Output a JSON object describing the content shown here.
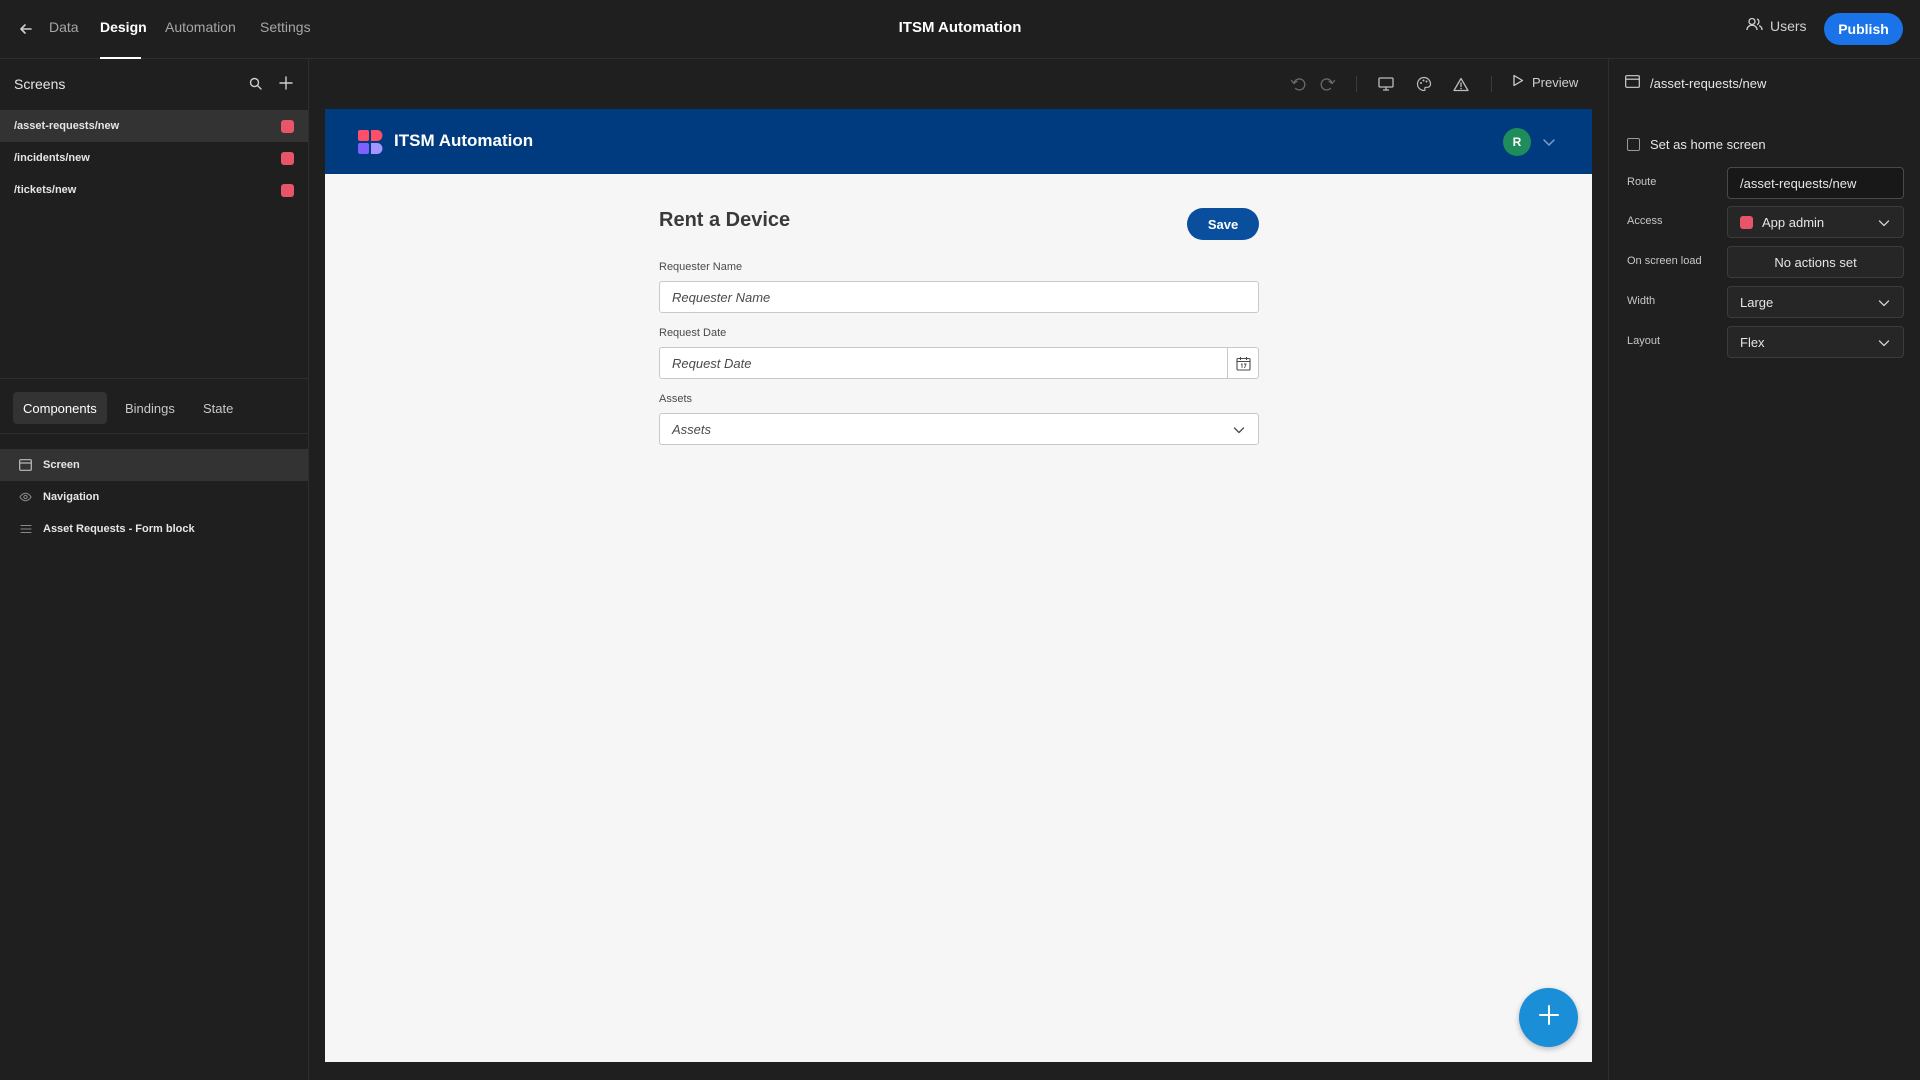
{
  "topbar": {
    "tabs": [
      "Data",
      "Design",
      "Automation",
      "Settings"
    ],
    "active_tab": "Design",
    "title": "ITSM Automation",
    "users_label": "Users",
    "publish_label": "Publish"
  },
  "screens": {
    "header": "Screens",
    "items": [
      {
        "route": "/asset-requests/new",
        "selected": true,
        "color": "#e8546a"
      },
      {
        "route": "/incidents/new",
        "selected": false,
        "color": "#e8546a"
      },
      {
        "route": "/tickets/new",
        "selected": false,
        "color": "#e8546a"
      }
    ]
  },
  "components_panel": {
    "tabs": [
      "Components",
      "Bindings",
      "State"
    ],
    "active_tab": "Components",
    "tree": [
      {
        "label": "Screen",
        "icon": "screen-icon",
        "selected": true
      },
      {
        "label": "Navigation",
        "icon": "eye-icon",
        "selected": false
      },
      {
        "label": "Asset Requests - Form block",
        "icon": "form-lines-icon",
        "selected": false
      }
    ]
  },
  "toolbar": {
    "icons": [
      "undo-icon",
      "redo-icon",
      "desktop-icon",
      "palette-icon",
      "warning-icon"
    ],
    "preview_label": "Preview"
  },
  "app_preview": {
    "app_name": "ITSM Automation",
    "nav_color": "#003b7f",
    "avatar_letter": "R",
    "form": {
      "title": "Rent a Device",
      "save_label": "Save",
      "fields": [
        {
          "label": "Requester Name",
          "placeholder": "Requester Name",
          "type": "text"
        },
        {
          "label": "Request Date",
          "placeholder": "Request Date",
          "type": "date"
        },
        {
          "label": "Assets",
          "placeholder": "Assets",
          "type": "select"
        }
      ]
    }
  },
  "settings_panel": {
    "route_header": "/asset-requests/new",
    "home_screen_label": "Set as home screen",
    "home_screen_checked": false,
    "rows": {
      "route": {
        "label": "Route",
        "value": "/asset-requests/new"
      },
      "access": {
        "label": "Access",
        "value": "App admin"
      },
      "on_load": {
        "label": "On screen load",
        "value": "No actions set"
      },
      "width": {
        "label": "Width",
        "value": "Large"
      },
      "layout": {
        "label": "Layout",
        "value": "Flex"
      }
    }
  },
  "colors": {
    "accent": "#1a73e8",
    "screen_dot": "#e8546a",
    "fab": "#1a8fd8",
    "save_button": "#0a4e9e"
  }
}
